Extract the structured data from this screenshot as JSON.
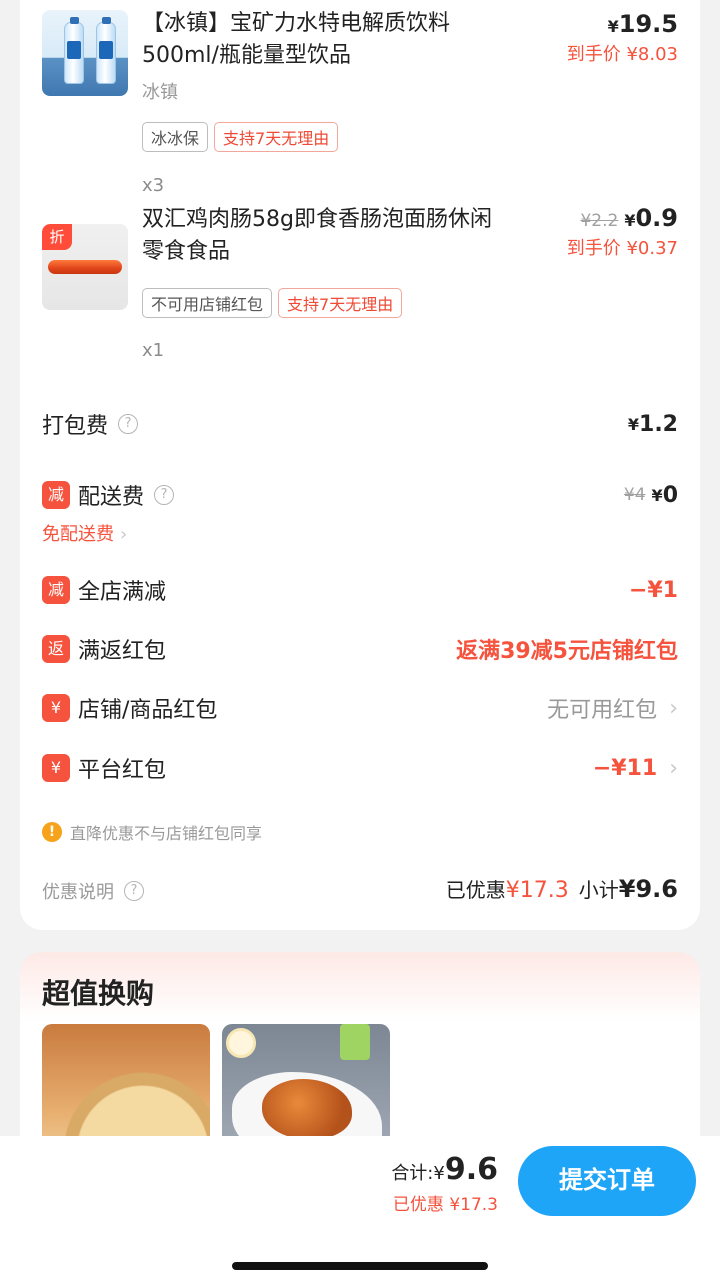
{
  "items": [
    {
      "title": "【冰镇】宝矿力水特电解质饮料500ml/瓶能量型饮品",
      "spec": "冰镇",
      "tags": [
        "冰冰保",
        "支持7天无理由"
      ],
      "qty": "x3",
      "price": "19.5",
      "arrive_label": "到手价",
      "arrive_price": "¥8.03"
    },
    {
      "title": "双汇鸡肉肠58g即食香肠泡面肠休闲零食食品",
      "badge": "折",
      "tags": [
        "不可用店铺红包",
        "支持7天无理由"
      ],
      "qty": "x1",
      "original_price": "¥2.2",
      "price": "0.9",
      "arrive_label": "到手价",
      "arrive_price": "¥0.37"
    }
  ],
  "fees": {
    "packing_label": "打包费",
    "packing_value": "1.2",
    "delivery_badge": "减",
    "delivery_label": "配送费",
    "delivery_original": "¥4",
    "delivery_value": "0",
    "free_delivery": "免配送费"
  },
  "discounts": [
    {
      "badge": "减",
      "label": "全店满减",
      "value": "−¥1",
      "style": "red",
      "chevron": false
    },
    {
      "badge": "返",
      "label": "满返红包",
      "value": "返满39减5元店铺红包",
      "style": "red",
      "chevron": false
    },
    {
      "badge": "¥",
      "label": "店铺/商品红包",
      "value": "无可用红包",
      "style": "gray",
      "chevron": true
    },
    {
      "badge": "¥",
      "label": "平台红包",
      "value": "−¥11",
      "style": "red",
      "chevron": true
    }
  ],
  "notice": "直降优惠不与店铺红包同享",
  "promo_label": "优惠说明",
  "summary": {
    "saved_label": "已优惠",
    "saved_value": "¥17.3",
    "subtotal_label": "小计",
    "subtotal_value": "¥9.6"
  },
  "swap": {
    "title": "超值换购"
  },
  "bottom": {
    "total_label": "合计:¥",
    "total_value": "9.6",
    "saved_text": "已优惠 ¥17.3",
    "submit_label": "提交订单"
  },
  "colors": {
    "accent_red": "#f5533d",
    "submit_blue": "#1ea5f7"
  }
}
